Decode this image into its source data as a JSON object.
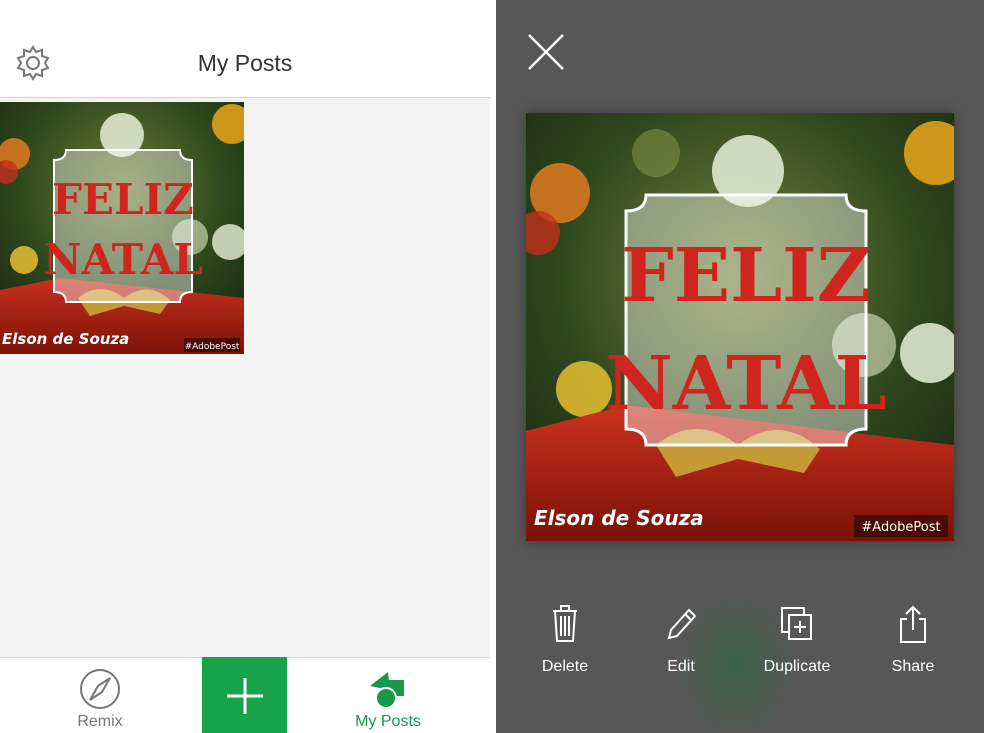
{
  "left": {
    "header": {
      "title": "My Posts"
    },
    "post": {
      "line1": "FELIZ",
      "line2": "NATAL",
      "author": "Elson de Souza",
      "tag": "#AdobePost"
    },
    "tabs": {
      "remix": "Remix",
      "my_posts": "My Posts"
    },
    "colors": {
      "accent": "#16a34a"
    }
  },
  "right": {
    "post": {
      "line1": "FELIZ",
      "line2": "NATAL",
      "author": "Elson de Souza",
      "tag": "#AdobePost"
    },
    "actions": {
      "delete": "Delete",
      "edit": "Edit",
      "duplicate": "Duplicate",
      "share": "Share"
    }
  }
}
